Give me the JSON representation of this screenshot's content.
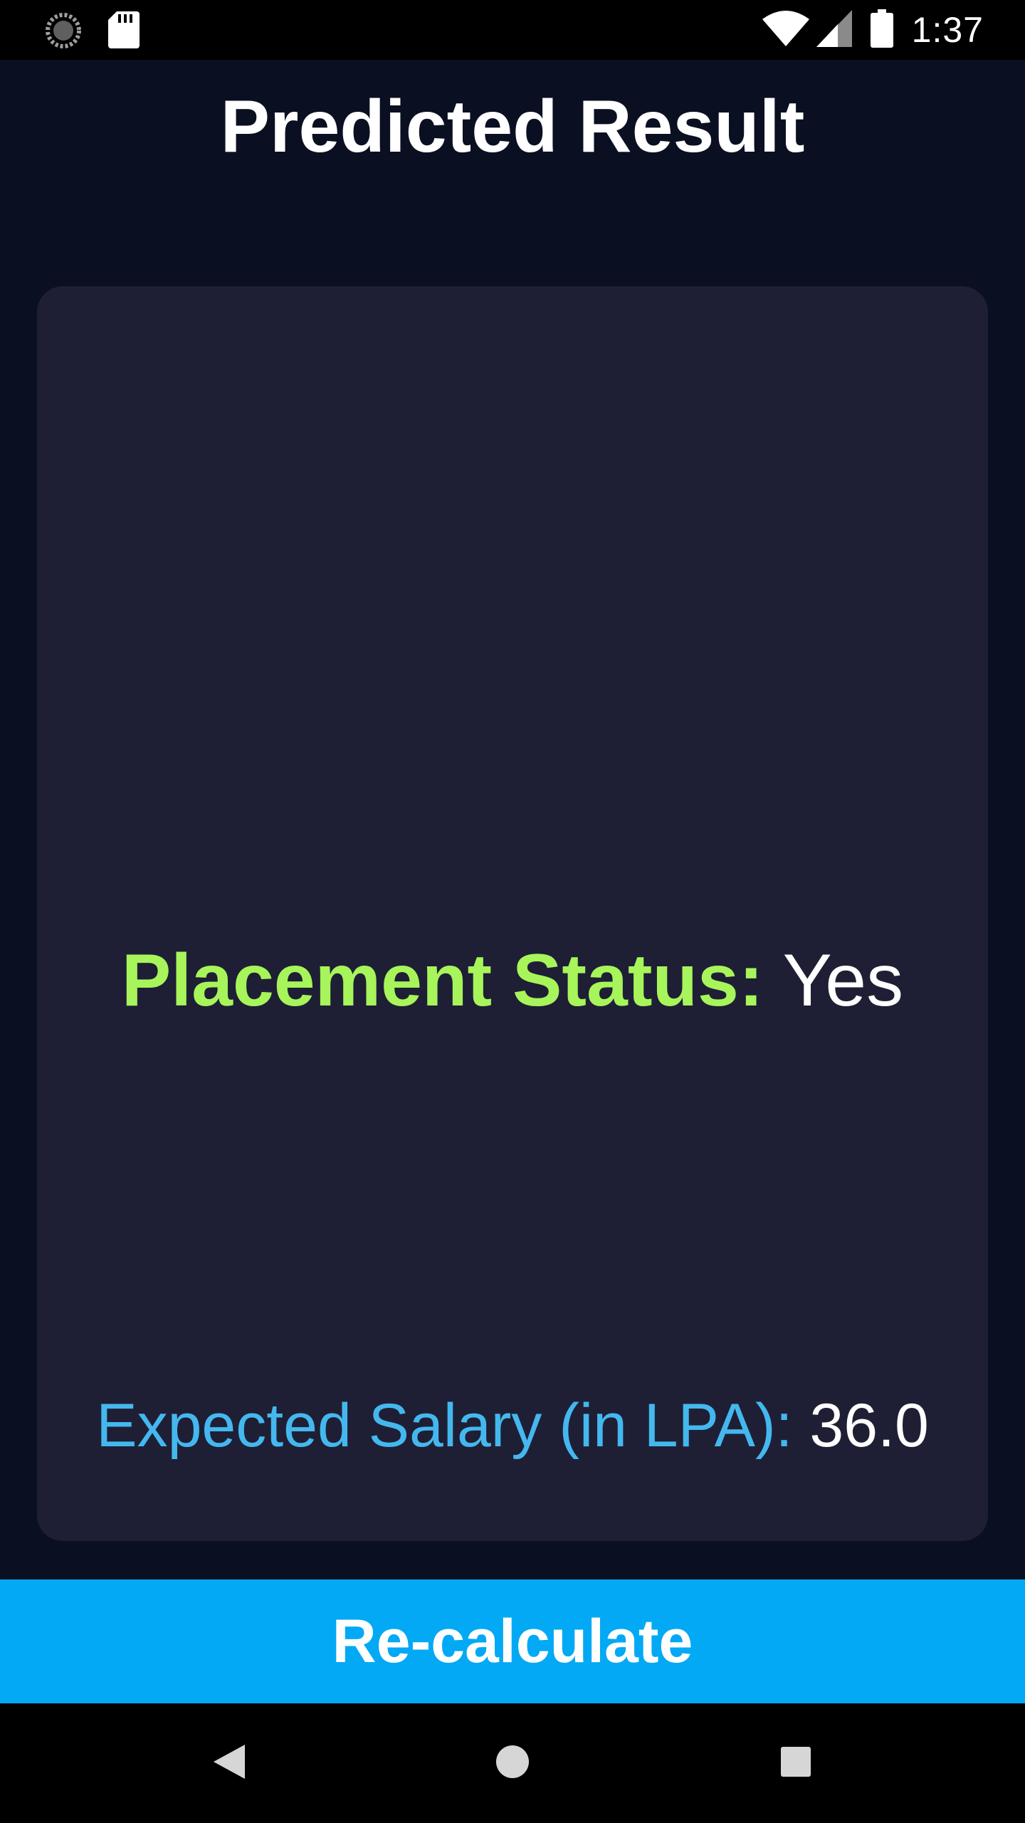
{
  "status_bar": {
    "time": "1:37",
    "left_icons": [
      "sync-icon",
      "sd-card-icon"
    ],
    "right_icons": [
      "wifi-icon",
      "signal-icon",
      "battery-icon"
    ]
  },
  "header": {
    "title": "Predicted Result"
  },
  "result": {
    "placement_label": "Placement Status:",
    "placement_value": "Yes",
    "salary_label": "Expected Salary (in LPA):",
    "salary_value": "36.0"
  },
  "actions": {
    "recalculate_label": "Re-calculate"
  },
  "nav_bar": {
    "buttons": [
      "back-icon",
      "home-icon",
      "recents-icon"
    ]
  },
  "colors": {
    "background": "#0b0f22",
    "card": "#1e1f35",
    "placement_label": "#a7f55a",
    "salary_label": "#44b8ee",
    "button": "#03a9f4"
  }
}
